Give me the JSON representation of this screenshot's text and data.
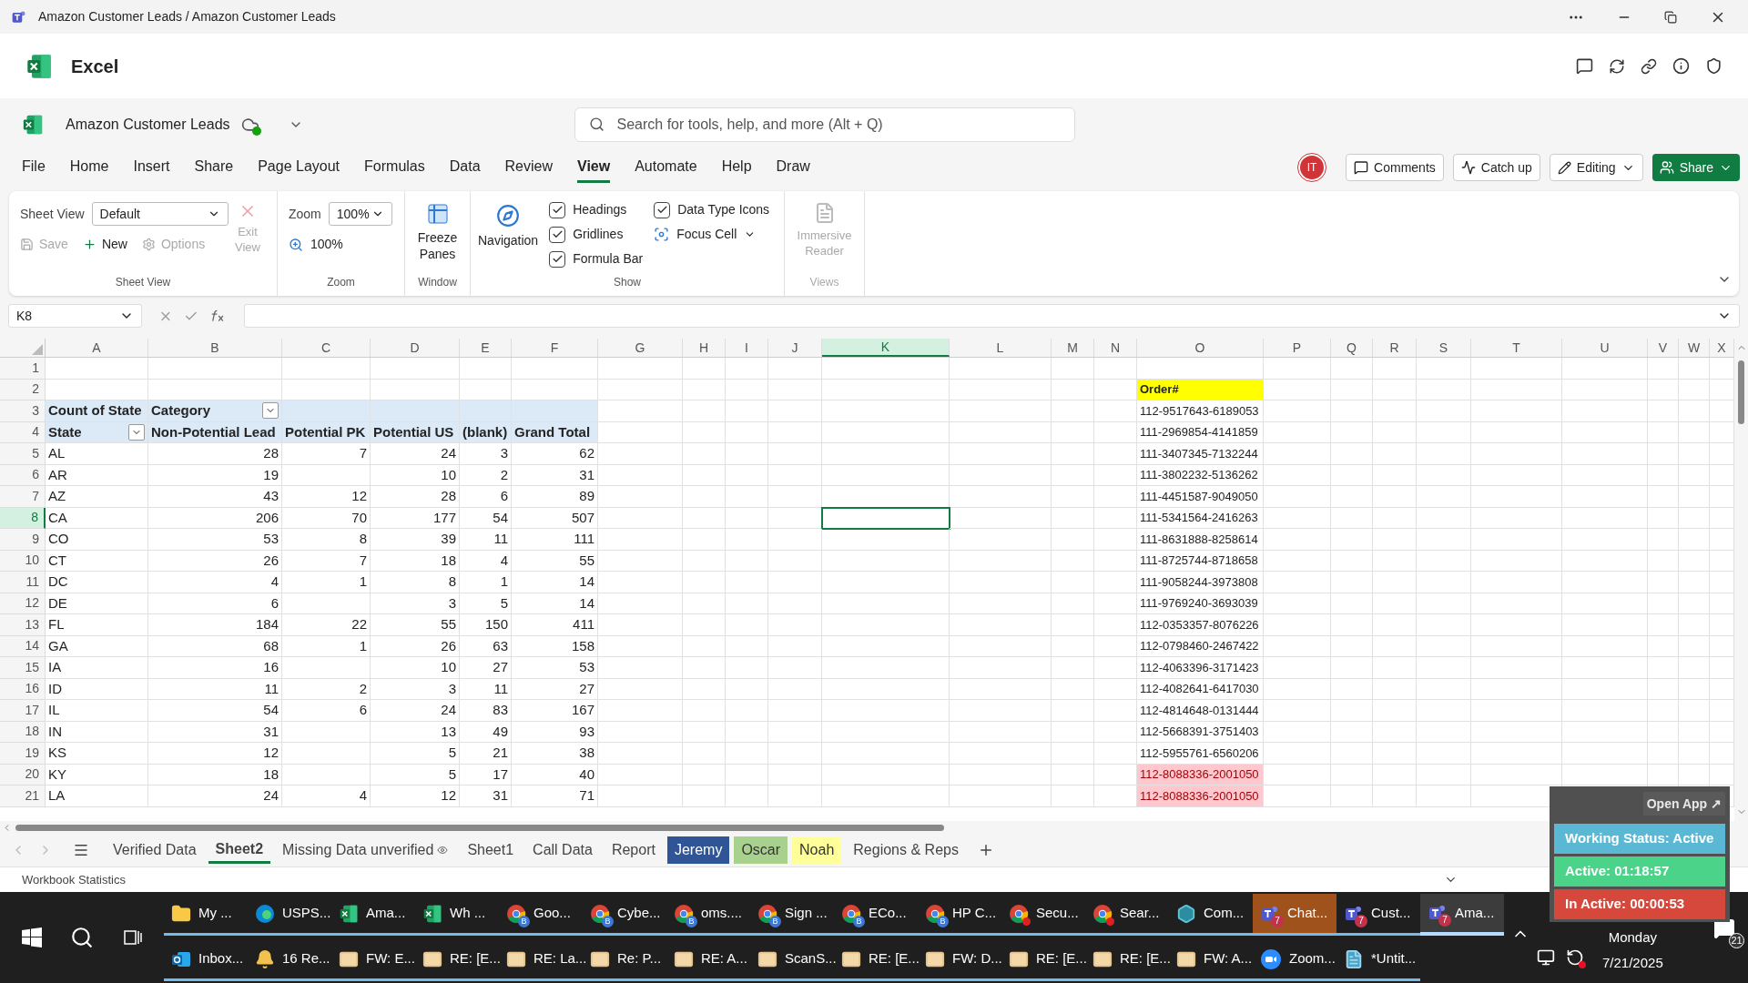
{
  "window": {
    "title": "Amazon Customer Leads / Amazon Customer Leads"
  },
  "app": {
    "name": "Excel"
  },
  "document": {
    "name": "Amazon Customer Leads"
  },
  "search": {
    "placeholder": "Search for tools, help, and more (Alt + Q)"
  },
  "menu": [
    {
      "label": "File",
      "selected": false
    },
    {
      "label": "Home",
      "selected": false
    },
    {
      "label": "Insert",
      "selected": false
    },
    {
      "label": "Share",
      "selected": false
    },
    {
      "label": "Page Layout",
      "selected": false
    },
    {
      "label": "Formulas",
      "selected": false
    },
    {
      "label": "Data",
      "selected": false
    },
    {
      "label": "Review",
      "selected": false
    },
    {
      "label": "View",
      "selected": true
    },
    {
      "label": "Automate",
      "selected": false
    },
    {
      "label": "Help",
      "selected": false
    },
    {
      "label": "Draw",
      "selected": false
    }
  ],
  "avatar": {
    "initials": "IT"
  },
  "actions": [
    {
      "label": "Comments",
      "kind": "comments"
    },
    {
      "label": "Catch up",
      "kind": "catchup"
    },
    {
      "label": "Editing",
      "kind": "editing"
    },
    {
      "label": "Share",
      "kind": "share"
    }
  ],
  "ribbon": {
    "sheet_view": {
      "label": "Sheet View",
      "value": "Default",
      "save": {
        "label": "Save",
        "disabled": true
      },
      "new": {
        "label": "New",
        "disabled": false
      },
      "options": {
        "label": "Options",
        "disabled": true
      },
      "exit": {
        "label": "Exit View",
        "disabled": true
      },
      "group": "Sheet View"
    },
    "zoom": {
      "label": "Zoom",
      "value": "100%",
      "button": "100%",
      "group": "Zoom"
    },
    "window": {
      "button": "Freeze Panes",
      "group": "Window"
    },
    "show": {
      "navigation": "Navigation",
      "checks": [
        {
          "label": "Headings",
          "checked": true
        },
        {
          "label": "Gridlines",
          "checked": true
        },
        {
          "label": "Formula Bar",
          "checked": true
        },
        {
          "label": "Data Type Icons",
          "checked": true
        }
      ],
      "focus_cell": "Focus Cell",
      "group": "Show"
    },
    "views": {
      "button": "Immersive Reader",
      "disabled": true,
      "group": "Views"
    }
  },
  "formula_bar": {
    "name_box": "K8"
  },
  "columns": [
    {
      "label": "A",
      "selected": false
    },
    {
      "label": "B",
      "selected": false
    },
    {
      "label": "C",
      "selected": false
    },
    {
      "label": "D",
      "selected": false
    },
    {
      "label": "E",
      "selected": false
    },
    {
      "label": "F",
      "selected": false
    },
    {
      "label": "G",
      "selected": false
    },
    {
      "label": "H",
      "selected": false
    },
    {
      "label": "I",
      "selected": false
    },
    {
      "label": "J",
      "selected": false
    },
    {
      "label": "K",
      "selected": true
    },
    {
      "label": "L",
      "selected": false
    },
    {
      "label": "M",
      "selected": false
    },
    {
      "label": "N",
      "selected": false
    },
    {
      "label": "O",
      "selected": false
    },
    {
      "label": "P",
      "selected": false
    },
    {
      "label": "Q",
      "selected": false
    },
    {
      "label": "R",
      "selected": false
    },
    {
      "label": "S",
      "selected": false
    },
    {
      "label": "T",
      "selected": false
    },
    {
      "label": "U",
      "selected": false
    },
    {
      "label": "V",
      "selected": false
    },
    {
      "label": "W",
      "selected": false
    },
    {
      "label": "X",
      "selected": false
    }
  ],
  "rows": [
    {
      "number": "1",
      "selected": false
    },
    {
      "number": "2",
      "selected": false
    },
    {
      "number": "3",
      "selected": false
    },
    {
      "number": "4",
      "selected": false
    },
    {
      "number": "5",
      "selected": false
    },
    {
      "number": "6",
      "selected": false
    },
    {
      "number": "7",
      "selected": false
    },
    {
      "number": "8",
      "selected": true
    },
    {
      "number": "9",
      "selected": false
    },
    {
      "number": "10",
      "selected": false
    },
    {
      "number": "11",
      "selected": false
    },
    {
      "number": "12",
      "selected": false
    },
    {
      "number": "13",
      "selected": false
    },
    {
      "number": "14",
      "selected": false
    },
    {
      "number": "15",
      "selected": false
    },
    {
      "number": "16",
      "selected": false
    },
    {
      "number": "17",
      "selected": false
    },
    {
      "number": "18",
      "selected": false
    },
    {
      "number": "19",
      "selected": false
    },
    {
      "number": "20",
      "selected": false
    },
    {
      "number": "21",
      "selected": false
    }
  ],
  "pivot": {
    "corner": "Count of State",
    "category": "Category",
    "header": [
      "State",
      "Non-Potential Lead",
      "Potential PK",
      "Potential US",
      "(blank)",
      "Grand Total"
    ],
    "rows": [
      [
        "AL",
        "28",
        "7",
        "24",
        "3",
        "62"
      ],
      [
        "AR",
        "19",
        null,
        "10",
        "2",
        "31"
      ],
      [
        "AZ",
        "43",
        "12",
        "28",
        "6",
        "89"
      ],
      [
        "CA",
        "206",
        "70",
        "177",
        "54",
        "507"
      ],
      [
        "CO",
        "53",
        "8",
        "39",
        "11",
        "111"
      ],
      [
        "CT",
        "26",
        "7",
        "18",
        "4",
        "55"
      ],
      [
        "DC",
        "4",
        "1",
        "8",
        "1",
        "14"
      ],
      [
        "DE",
        "6",
        null,
        "3",
        "5",
        "14"
      ],
      [
        "FL",
        "184",
        "22",
        "55",
        "150",
        "411"
      ],
      [
        "GA",
        "68",
        "1",
        "26",
        "63",
        "158"
      ],
      [
        "IA",
        "16",
        null,
        "10",
        "27",
        "53"
      ],
      [
        "ID",
        "11",
        "2",
        "3",
        "11",
        "27"
      ],
      [
        "IL",
        "54",
        "6",
        "24",
        "83",
        "167"
      ],
      [
        "IN",
        "31",
        null,
        "13",
        "49",
        "93"
      ],
      [
        "KS",
        "12",
        null,
        "5",
        "21",
        "38"
      ],
      [
        "KY",
        "18",
        null,
        "5",
        "17",
        "40"
      ],
      [
        "LA",
        "24",
        "4",
        "12",
        "31",
        "71"
      ]
    ]
  },
  "orders": {
    "header": "Order#",
    "values": [
      {
        "text": "112-9517643-6189053",
        "duplicate": false
      },
      {
        "text": "111-2969854-4141859",
        "duplicate": false
      },
      {
        "text": "111-3407345-7132244",
        "duplicate": false
      },
      {
        "text": "111-3802232-5136262",
        "duplicate": false
      },
      {
        "text": "111-4451587-9049050",
        "duplicate": false
      },
      {
        "text": "111-5341564-2416263",
        "duplicate": false
      },
      {
        "text": "111-8631888-8258614",
        "duplicate": false
      },
      {
        "text": "111-8725744-8718658",
        "duplicate": false
      },
      {
        "text": "111-9058244-3973808",
        "duplicate": false
      },
      {
        "text": "111-9769240-3693039",
        "duplicate": false
      },
      {
        "text": "112-0353357-8076226",
        "duplicate": false
      },
      {
        "text": "112-0798460-2467422",
        "duplicate": false
      },
      {
        "text": "112-4063396-3171423",
        "duplicate": false
      },
      {
        "text": "112-4082641-6417030",
        "duplicate": false
      },
      {
        "text": "112-4814648-0131444",
        "duplicate": false
      },
      {
        "text": "112-5668391-3751403",
        "duplicate": false
      },
      {
        "text": "112-5955761-6560206",
        "duplicate": false
      },
      {
        "text": "112-8088336-2001050",
        "duplicate": true
      },
      {
        "text": "112-8088336-2001050",
        "duplicate": true
      }
    ]
  },
  "sheet_tabs": [
    {
      "label": "Verified Data",
      "selected": false
    },
    {
      "label": "Sheet2",
      "selected": true
    },
    {
      "label": "Missing Data unverified",
      "selected": false,
      "watched": true
    },
    {
      "label": "Sheet1",
      "selected": false
    },
    {
      "label": "Call Data",
      "selected": false
    },
    {
      "label": "Report",
      "selected": false
    },
    {
      "label": "Jeremy",
      "selected": false,
      "color": "#2f5597"
    },
    {
      "label": "Oscar",
      "selected": false,
      "color": "#a9d18e"
    },
    {
      "label": "Noah",
      "selected": false,
      "color": "#ffff99"
    },
    {
      "label": "Regions & Reps",
      "selected": false
    }
  ],
  "status_bar": {
    "text": "Workbook Statistics"
  },
  "tracker": {
    "open": "Open App ↗",
    "status": "Working Status: Active",
    "active": "Active: 01:18:57",
    "inactive": "In Active: 00:00:53"
  },
  "taskbar": {
    "row1": [
      {
        "label": "My ...",
        "kind": "folder",
        "flashing": false,
        "selected": false
      },
      {
        "label": "USPS...",
        "kind": "edge",
        "flashing": false,
        "selected": false
      },
      {
        "label": "Ama...",
        "kind": "excel",
        "flashing": false,
        "selected": false
      },
      {
        "label": "Wh ...",
        "kind": "excel",
        "flashing": false,
        "selected": false
      },
      {
        "label": "Goo...",
        "kind": "chrome",
        "badge": "B",
        "flashing": false,
        "selected": false
      },
      {
        "label": "Cybe...",
        "kind": "chrome",
        "badge": "B",
        "flashing": false,
        "selected": false
      },
      {
        "label": "oms....",
        "kind": "chrome",
        "badge": "B",
        "flashing": false,
        "selected": false
      },
      {
        "label": "Sign ...",
        "kind": "chrome",
        "badge": "B",
        "flashing": false,
        "selected": false
      },
      {
        "label": "ECo...",
        "kind": "chrome",
        "badge": "B",
        "flashing": false,
        "selected": false
      },
      {
        "label": "HP C...",
        "kind": "chrome",
        "badge": "B",
        "flashing": false,
        "selected": false
      },
      {
        "label": "Secu...",
        "kind": "chrome-red",
        "flashing": false,
        "selected": false
      },
      {
        "label": "Sear...",
        "kind": "chrome-red",
        "flashing": false,
        "selected": false
      },
      {
        "label": "Com...",
        "kind": "app",
        "flashing": false,
        "selected": false
      },
      {
        "label": "Chat...",
        "kind": "teams",
        "badge": "7",
        "flashing": true,
        "selected": false
      },
      {
        "label": "Cust...",
        "kind": "teams",
        "badge": "7",
        "flashing": false,
        "selected": false
      },
      {
        "label": "Ama...",
        "kind": "teams",
        "badge": "7",
        "flashing": false,
        "selected": true
      }
    ],
    "row2": [
      {
        "label": "Inbox...",
        "kind": "outlook"
      },
      {
        "label": "16 Re...",
        "kind": "bell"
      },
      {
        "label": "FW: E...",
        "kind": "mail"
      },
      {
        "label": "RE: [E...",
        "kind": "mail"
      },
      {
        "label": "RE: La...",
        "kind": "mail"
      },
      {
        "label": "Re: P...",
        "kind": "mail"
      },
      {
        "label": "RE: A...",
        "kind": "mail"
      },
      {
        "label": "ScanS...",
        "kind": "mail"
      },
      {
        "label": "RE: [E...",
        "kind": "mail"
      },
      {
        "label": "FW: D...",
        "kind": "mail"
      },
      {
        "label": "RE: [E...",
        "kind": "mail"
      },
      {
        "label": "RE: [E...",
        "kind": "mail"
      },
      {
        "label": "FW: A...",
        "kind": "mail"
      },
      {
        "label": "Zoom...",
        "kind": "zoom"
      },
      {
        "label": "*Untit...",
        "kind": "notepad"
      }
    ],
    "clock": {
      "day": "Monday",
      "date": "7/21/2025"
    },
    "notifications": "21"
  }
}
